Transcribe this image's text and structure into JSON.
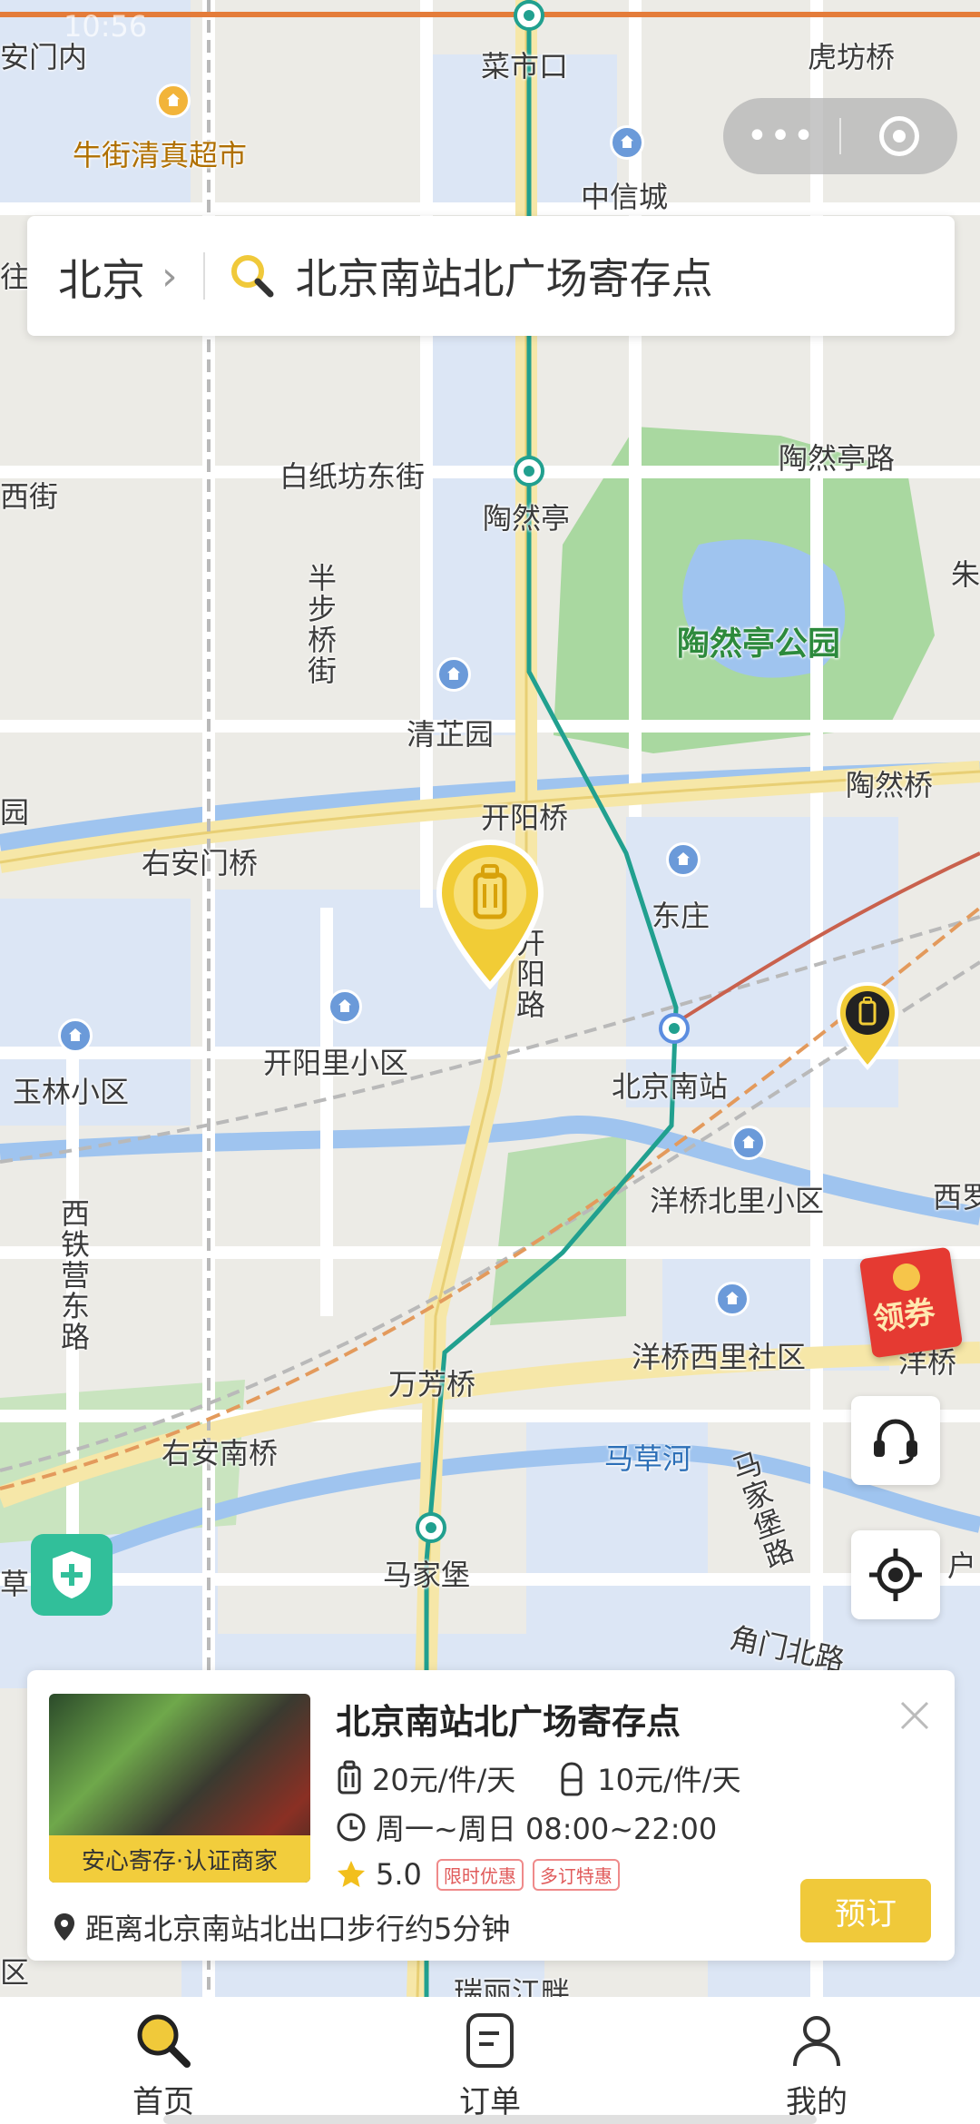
{
  "status_bar": {
    "time": "10:56"
  },
  "capsule": {
    "menu_icon": "more-dots-icon",
    "close_icon": "target-ring-icon"
  },
  "search": {
    "city": "北京",
    "chevron": "›",
    "query": "北京南站北广场寄存点"
  },
  "map_labels": {
    "l1": "安门内",
    "l2": "菜市口",
    "l3": "虎坊桥",
    "l4": "牛街清真超市",
    "l5": "中信城",
    "l6": "往",
    "l7": "白纸坊东街",
    "l8": "陶然亭路",
    "l9": "西街",
    "l10": "陶然亭",
    "l11": "朱",
    "l12": "半步桥街",
    "l13": "陶然亭公园",
    "l14": "清芷园",
    "l15": "陶然桥",
    "l16": "园",
    "l17": "开阳桥",
    "l18": "右安门桥",
    "l19": "东庄",
    "l20": "开阳路",
    "l21": "开阳里小区",
    "l22": "北京南站",
    "l23": "玉林小区",
    "l24": "洋桥北里小区",
    "l25": "西罗",
    "l26": "西铁营东路",
    "l27": "洋桥西里社区",
    "l28": "洋桥",
    "l29": "万芳桥",
    "l30": "右安南桥",
    "l31": "马草河",
    "l32": "马家堡路",
    "l33": "草",
    "l34": "马家堡",
    "l35": "角门北路",
    "l36": "区",
    "l37": "瑞丽江畔",
    "l38": "户"
  },
  "side_buttons": {
    "coupon": "领券",
    "support_icon": "headset-icon",
    "locate_icon": "locate-icon",
    "shield_icon": "shield-plus-icon"
  },
  "store_card": {
    "name": "北京南站北广场寄存点",
    "badge": "安心寄存·认证商家",
    "price_small": "20元/件/天",
    "price_large": "10元/件/天",
    "hours": "周一~周日 08:00~22:00",
    "rating": "5.0",
    "tags": [
      "限时优惠",
      "多订特惠"
    ],
    "distance": "距离北京南站北出口步行约5分钟",
    "book_label": "预订"
  },
  "tabs": [
    {
      "label": "首页",
      "icon": "search-icon",
      "active": true
    },
    {
      "label": "订单",
      "icon": "order-icon",
      "active": false
    },
    {
      "label": "我的",
      "icon": "profile-icon",
      "active": false
    }
  ],
  "colors": {
    "accent": "#f0c93a",
    "metro_line": "#21a08f",
    "tag_red": "#e05a5a",
    "park": "#a9d8a0",
    "water": "#9fc4ef"
  }
}
